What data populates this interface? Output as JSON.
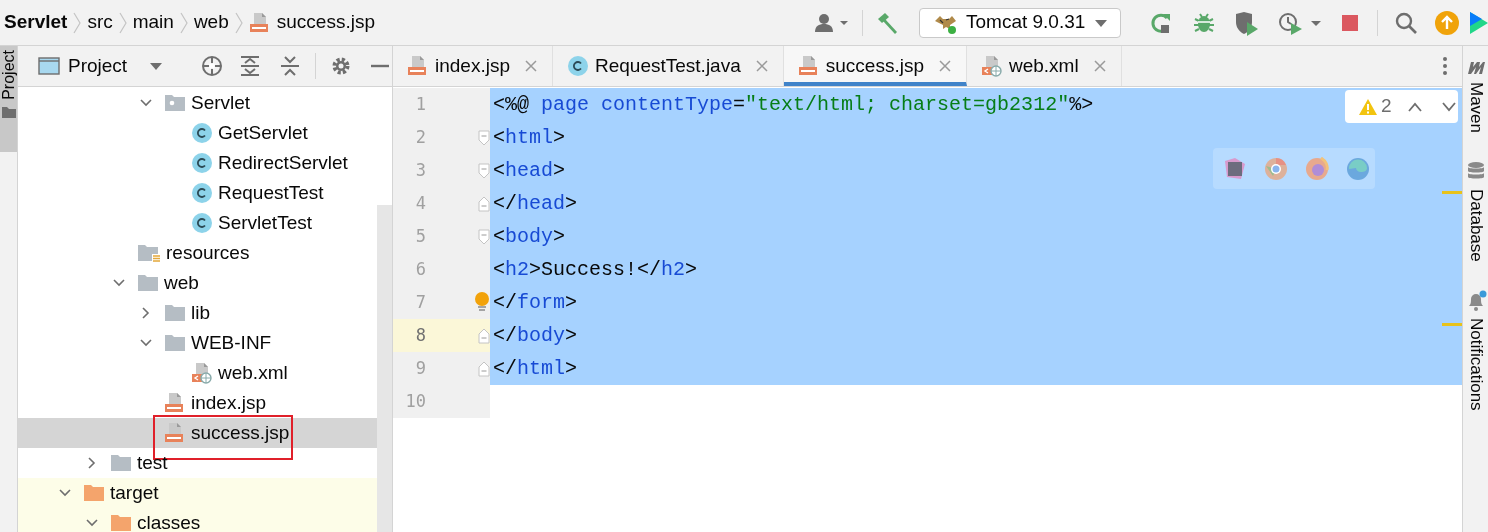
{
  "breadcrumbs": [
    {
      "label": "Servlet",
      "kind": "project"
    },
    {
      "label": "src",
      "kind": "dir"
    },
    {
      "label": "main",
      "kind": "dir"
    },
    {
      "label": "web",
      "kind": "dir"
    },
    {
      "label": "success.jsp",
      "kind": "jsp"
    }
  ],
  "toolbar": {
    "run_config": "Tomcat 9.0.31"
  },
  "left_strip": {
    "label": "Project",
    "selected": true
  },
  "project_panel": {
    "title": "Project",
    "tree": [
      {
        "children": [
          {
            "children": [
              {
                "children": [
                  {
                    "label": "Servlet",
                    "kind": "package",
                    "expanded": true,
                    "selected": false,
                    "children": [
                      {
                        "label": "GetServlet",
                        "kind": "class",
                        "selected": false
                      },
                      {
                        "label": "RedirectServlet",
                        "kind": "class",
                        "selected": false
                      },
                      {
                        "label": "RequestTest",
                        "kind": "class",
                        "selected": false
                      },
                      {
                        "label": "ServletTest",
                        "kind": "class",
                        "selected": false
                      }
                    ]
                  }
                ]
              },
              {
                "label": "resources",
                "kind": "resources",
                "selected": false
              },
              {
                "label": "web",
                "kind": "folder",
                "expanded": true,
                "selected": false,
                "children": [
                  {
                    "label": "lib",
                    "kind": "folder",
                    "expanded": false,
                    "selected": false
                  },
                  {
                    "label": "WEB-INF",
                    "kind": "folder",
                    "expanded": true,
                    "selected": false,
                    "children": [
                      {
                        "label": "web.xml",
                        "kind": "xml",
                        "selected": false
                      }
                    ]
                  },
                  {
                    "label": "index.jsp",
                    "kind": "jsp",
                    "selected": false
                  },
                  {
                    "label": "success.jsp",
                    "kind": "jsp",
                    "selected": true,
                    "highlighted": true
                  }
                ]
              }
            ]
          },
          {
            "label": "test",
            "kind": "folder",
            "expanded": false,
            "selected": false
          }
        ]
      },
      {
        "label": "target",
        "kind": "excluded",
        "expanded": true,
        "selected": false,
        "children": [
          {
            "label": "classes",
            "kind": "excluded",
            "expanded": true,
            "selected": false
          }
        ]
      }
    ]
  },
  "editor": {
    "tabs": [
      {
        "label": "index.jsp",
        "kind": "jsp",
        "selected": false
      },
      {
        "label": "RequestTest.java",
        "kind": "class",
        "selected": false
      },
      {
        "label": "success.jsp",
        "kind": "jsp",
        "selected": true
      },
      {
        "label": "web.xml",
        "kind": "xml",
        "selected": false
      }
    ],
    "lines": [
      {
        "number": "1",
        "selected": true,
        "current": false,
        "fold_start": false,
        "fold_end": false,
        "tokens": [
          {
            "text": "<%@ ",
            "kind": "punct"
          },
          {
            "text": "page ",
            "kind": "tag"
          },
          {
            "text": "contentType",
            "kind": "attr"
          },
          {
            "text": "=",
            "kind": "punct"
          },
          {
            "text": "\"text/html; charset=gb2312\"",
            "kind": "string"
          },
          {
            "text": "%>",
            "kind": "punct"
          }
        ]
      },
      {
        "number": "2",
        "selected": true,
        "current": false,
        "fold_start": true,
        "fold_end": false,
        "tokens": [
          {
            "text": "<",
            "kind": "punct"
          },
          {
            "text": "html",
            "kind": "tag"
          },
          {
            "text": ">",
            "kind": "punct"
          }
        ]
      },
      {
        "number": "3",
        "selected": true,
        "current": false,
        "fold_start": true,
        "fold_end": false,
        "tokens": [
          {
            "text": "<",
            "kind": "punct"
          },
          {
            "text": "head",
            "kind": "tag"
          },
          {
            "text": ">",
            "kind": "punct"
          }
        ]
      },
      {
        "number": "4",
        "selected": true,
        "current": false,
        "fold_start": false,
        "fold_end": true,
        "tokens": [
          {
            "text": "</",
            "kind": "punct"
          },
          {
            "text": "head",
            "kind": "tag"
          },
          {
            "text": ">",
            "kind": "punct"
          }
        ]
      },
      {
        "number": "5",
        "selected": true,
        "current": false,
        "fold_start": true,
        "fold_end": false,
        "tokens": [
          {
            "text": "<",
            "kind": "punct"
          },
          {
            "text": "body",
            "kind": "tag"
          },
          {
            "text": ">",
            "kind": "punct"
          }
        ]
      },
      {
        "number": "6",
        "selected": true,
        "current": false,
        "fold_start": false,
        "fold_end": false,
        "tokens": [
          {
            "text": "<",
            "kind": "punct"
          },
          {
            "text": "h2",
            "kind": "tag"
          },
          {
            "text": ">",
            "kind": "punct"
          },
          {
            "text": "Success!",
            "kind": "text"
          },
          {
            "text": "</",
            "kind": "punct"
          },
          {
            "text": "h2",
            "kind": "tag"
          },
          {
            "text": ">",
            "kind": "punct"
          }
        ]
      },
      {
        "number": "7",
        "selected": true,
        "current": false,
        "fold_start": false,
        "fold_end": false,
        "bulb": true,
        "tokens": [
          {
            "text": "</",
            "kind": "punct"
          },
          {
            "text": "form",
            "kind": "tag"
          },
          {
            "text": ">",
            "kind": "punct"
          }
        ]
      },
      {
        "number": "8",
        "selected": true,
        "current": true,
        "fold_start": false,
        "fold_end": true,
        "tokens": [
          {
            "text": "</",
            "kind": "punct"
          },
          {
            "text": "body",
            "kind": "tag"
          },
          {
            "text": ">",
            "kind": "punct"
          }
        ]
      },
      {
        "number": "9",
        "selected": true,
        "current": false,
        "fold_start": false,
        "fold_end": true,
        "tokens": [
          {
            "text": "</",
            "kind": "punct"
          },
          {
            "text": "html",
            "kind": "tag"
          },
          {
            "text": ">",
            "kind": "punct"
          }
        ]
      },
      {
        "number": "10",
        "selected": false,
        "current": false,
        "fold_start": false,
        "fold_end": false
      }
    ],
    "warnings": "2"
  },
  "right_strip": [
    {
      "label": "Maven",
      "kind": "maven"
    },
    {
      "label": "Database",
      "kind": "database"
    },
    {
      "label": "Notifications",
      "kind": "notifications"
    }
  ]
}
